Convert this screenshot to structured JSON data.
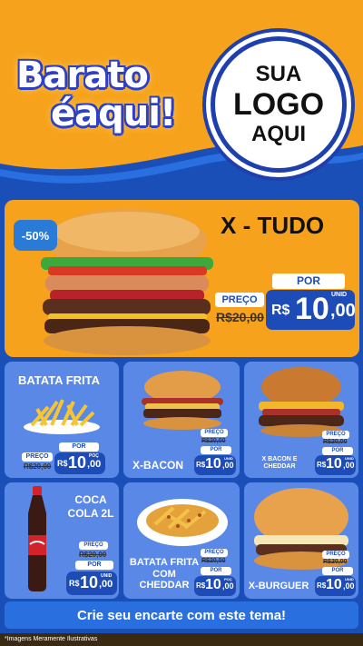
{
  "header": {
    "brand_line1": "Barato",
    "brand_line2": "éaqui!",
    "logo_line1": "SUA",
    "logo_line2": "LOGO",
    "logo_line3": "AQUI"
  },
  "featured": {
    "discount": "-50%",
    "title": "X - TUDO",
    "preco_label": "PREÇO",
    "old_price": "R$20,00",
    "por_label": "POR",
    "currency": "R$",
    "price_int": "10",
    "price_dec": ",00",
    "unit": "UNID"
  },
  "products": [
    {
      "name": "BATATA FRITA",
      "preco_label": "PREÇO",
      "old_price": "R$20,00",
      "por_label": "POR",
      "currency": "R$",
      "price_int": "10",
      "price_dec": ",00",
      "unit": "POÇ"
    },
    {
      "name": "X-BACON",
      "preco_label": "PREÇO",
      "old_price": "R$20,00",
      "por_label": "POR",
      "currency": "R$",
      "price_int": "10",
      "price_dec": ",00",
      "unit": "UNID"
    },
    {
      "name": "X BACON E CHEDDAR",
      "preco_label": "PREÇO",
      "old_price": "R$20,00",
      "por_label": "POR",
      "currency": "R$",
      "price_int": "10",
      "price_dec": ",00",
      "unit": "UNID"
    },
    {
      "name": "COCA COLA 2L",
      "preco_label": "PREÇO",
      "old_price": "R$20,00",
      "por_label": "POR",
      "currency": "R$",
      "price_int": "10",
      "price_dec": ",00",
      "unit": "UNID"
    },
    {
      "name": "BATATA FRITA COM CHEDDAR",
      "preco_label": "PREÇO",
      "old_price": "R$20,00",
      "por_label": "POR",
      "currency": "R$",
      "price_int": "10",
      "price_dec": ",00",
      "unit": "POÇ"
    },
    {
      "name": "X-BURGUER",
      "preco_label": "PREÇO",
      "old_price": "R$20,00",
      "por_label": "POR",
      "currency": "R$",
      "price_int": "10",
      "price_dec": ",00",
      "unit": "UNID"
    }
  ],
  "cta": {
    "label": "Crie seu encarte com este tema!"
  },
  "footnote": "*Imagens Meramente Ilustrativas",
  "colors": {
    "orange": "#f6a21c",
    "blue": "#1b4fb8",
    "card": "#5a88e6"
  },
  "icons": [
    "burger-icon",
    "fries-icon",
    "soda-bottle-icon",
    "cheddar-fries-icon"
  ]
}
